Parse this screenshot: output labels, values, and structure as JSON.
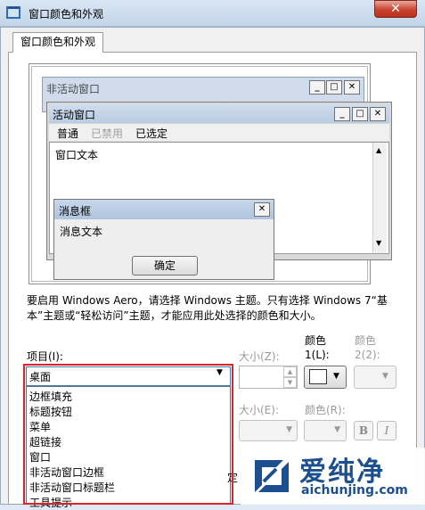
{
  "window": {
    "title": "窗口颜色和外观",
    "close_glyph": "✕"
  },
  "tab": {
    "label": "窗口颜色和外观"
  },
  "preview": {
    "inactive_title": "非活动窗口",
    "active_title": "活动窗口",
    "menu": {
      "normal": "普通",
      "disabled": "已禁用",
      "selected": "已选定"
    },
    "window_text": "窗口文本",
    "message_title": "消息框",
    "message_text": "消息文本",
    "ok_label": "确定",
    "min_glyph": "_",
    "max_glyph": "□",
    "close_glyph": "✕"
  },
  "description": "要启用 Windows Aero，请选择 Windows 主题。只有选择 Windows 7“基本”主题或“轻松访问”主题，才能应用此处选择的颜色和大小。",
  "item": {
    "label": "项目(I):",
    "selected": "桌面",
    "options": [
      "边框填充",
      "标题按钮",
      "菜单",
      "超链接",
      "窗口",
      "非活动窗口边框",
      "非活动窗口标题栏",
      "工具提示"
    ]
  },
  "size1": {
    "label": "大小(Z):"
  },
  "color1": {
    "label_top": "颜色",
    "label_bottom": "1(L):",
    "swatch": "#ffffff"
  },
  "color2": {
    "label_top": "颜色",
    "label_bottom": "2(2):"
  },
  "font_row": {
    "size_label": "大小(E):",
    "color_label": "颜色(R):",
    "bold": "B",
    "italic": "I"
  },
  "footer": {
    "confirm_label": "定"
  },
  "watermark": {
    "text": "爱纯净",
    "url": "aichunjing.com"
  },
  "colors": {
    "highlight": "#d9242d",
    "title_gradient": "#c3d5ea",
    "watermark": "#1c4f8f"
  }
}
